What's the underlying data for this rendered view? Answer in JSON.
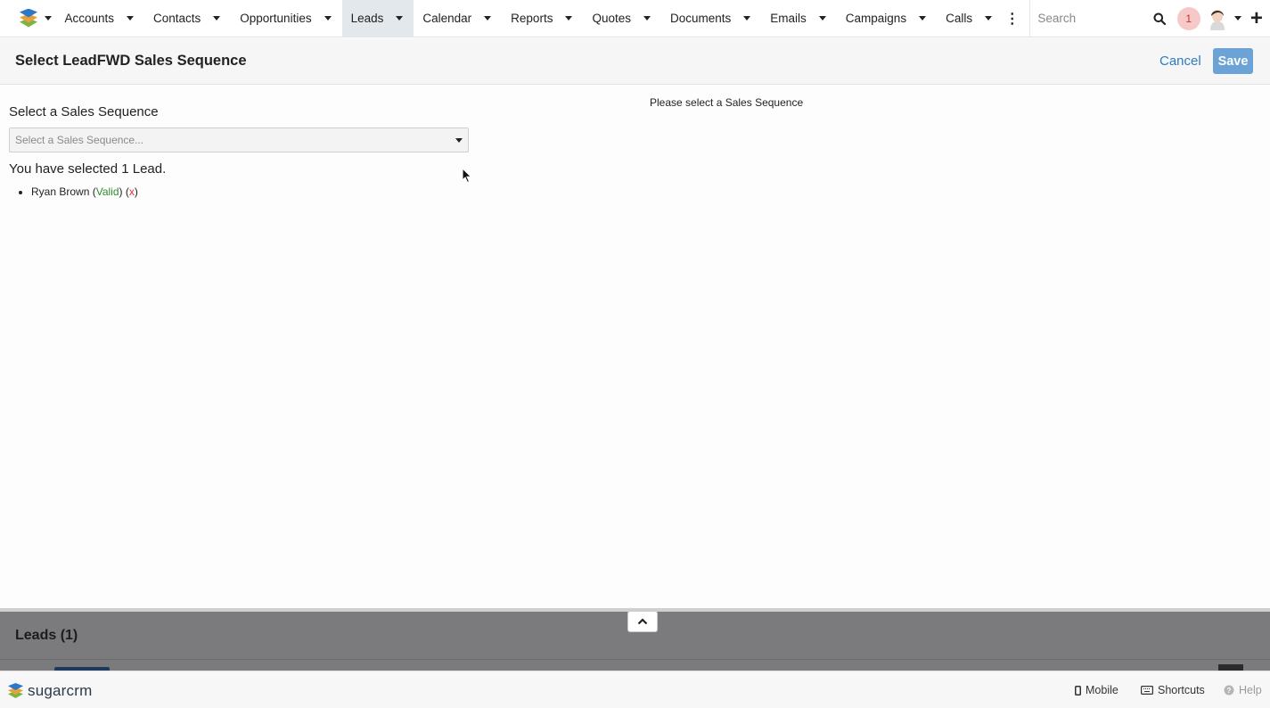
{
  "nav": {
    "items": [
      {
        "label": "Accounts",
        "active": false
      },
      {
        "label": "Contacts",
        "active": false
      },
      {
        "label": "Opportunities",
        "active": false
      },
      {
        "label": "Leads",
        "active": true
      },
      {
        "label": "Calendar",
        "active": false
      },
      {
        "label": "Reports",
        "active": false
      },
      {
        "label": "Quotes",
        "active": false
      },
      {
        "label": "Documents",
        "active": false
      },
      {
        "label": "Emails",
        "active": false
      },
      {
        "label": "Campaigns",
        "active": false
      },
      {
        "label": "Calls",
        "active": false
      }
    ],
    "search_placeholder": "Search",
    "notification_count": "1"
  },
  "header": {
    "title": "Select LeadFWD Sales Sequence",
    "cancel_label": "Cancel",
    "save_label": "Save"
  },
  "main": {
    "select_label": "Select a Sales Sequence",
    "select_placeholder": "Select a Sales Sequence...",
    "selected_count_text": "You have selected 1 Lead.",
    "leads": [
      {
        "name": "Ryan Brown",
        "status": "Valid",
        "remove": "x"
      }
    ],
    "right_message": "Please select a Sales Sequence"
  },
  "drawer": {
    "title": "Leads (1)"
  },
  "footer": {
    "brand": "sugarcrm",
    "mobile_label": "Mobile",
    "shortcuts_label": "Shortcuts",
    "help_label": "Help"
  },
  "colors": {
    "accent": "#2d7cc1",
    "save_button": "#6ba3d6",
    "valid": "#2e8b2e",
    "remove": "#dd3333",
    "active_tab": "#e3e8ec",
    "notification_bg": "#f7c8c8"
  }
}
